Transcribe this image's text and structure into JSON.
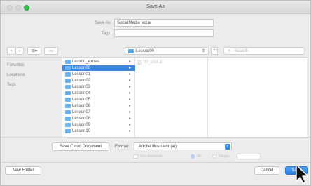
{
  "window": {
    "title": "Save As"
  },
  "form": {
    "save_as_label": "Save As:",
    "save_as_value": "SocialMedia_ad.ai",
    "tags_label": "Tags:",
    "tags_value": ""
  },
  "toolbar": {
    "back_glyph": "‹",
    "forward_glyph": "›",
    "view_glyph": "⊞▾",
    "new_folder_glyph": "▭",
    "location": "Lesson00",
    "expand_glyph": "⌃",
    "search_placeholder": "Search"
  },
  "sidebar": {
    "items": [
      "Favorites",
      "Locations",
      "Tags"
    ]
  },
  "browser": {
    "column1": [
      "Lesson_extras",
      "Lesson00",
      "Lesson01",
      "Lesson02",
      "Lesson03",
      "Lesson04",
      "Lesson05",
      "Lesson06",
      "Lesson07",
      "Lesson08",
      "Lesson09",
      "Lesson10"
    ],
    "selected_index": 1,
    "column2_file": "00_end.ai"
  },
  "format": {
    "save_cloud_label": "Save Cloud Document",
    "label": "Format:",
    "value": "Adobe Illustrator (ai)",
    "use_artboards_label": "Use Artboards",
    "all_label": "All",
    "range_label": "Range:",
    "range_value": ""
  },
  "footer": {
    "new_folder_label": "New Folder",
    "cancel_label": "Cancel",
    "save_label": "Save"
  },
  "colors": {
    "accent": "#3a88e0",
    "window_bg": "#ececec"
  }
}
